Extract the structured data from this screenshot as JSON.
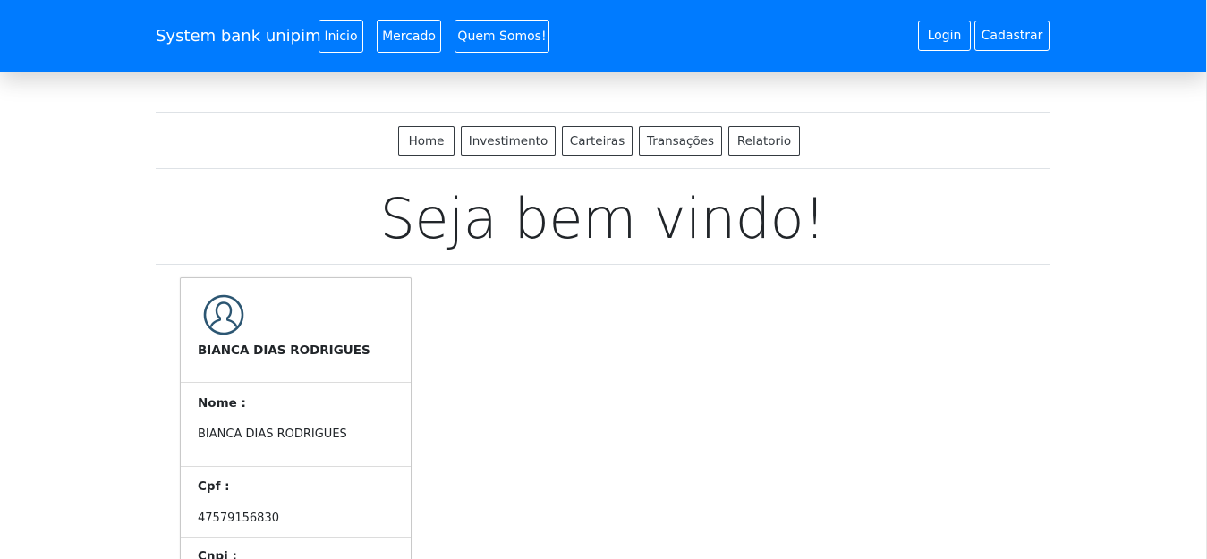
{
  "navbar": {
    "brand": "System bank unipim",
    "links": [
      "Inicio",
      "Mercado",
      "Quem Somos!"
    ],
    "login_label": "Login",
    "register_label": "Cadastrar",
    "background_color": "#007bff"
  },
  "subnav": {
    "items": [
      "Home",
      "Investimento",
      "Carteiras",
      "Transações",
      "Relatorio"
    ]
  },
  "welcome": "Seja bem vindo!",
  "profile": {
    "avatar_icon": "user-circle-icon",
    "name": "BIANCA DIAS RODRIGUES",
    "fields": [
      {
        "label": "Nome :",
        "value": "BIANCA DIAS RODRIGUES"
      },
      {
        "label": "Cpf :",
        "value": "47579156830"
      },
      {
        "label": "Cnpj :",
        "value": ""
      }
    ]
  }
}
